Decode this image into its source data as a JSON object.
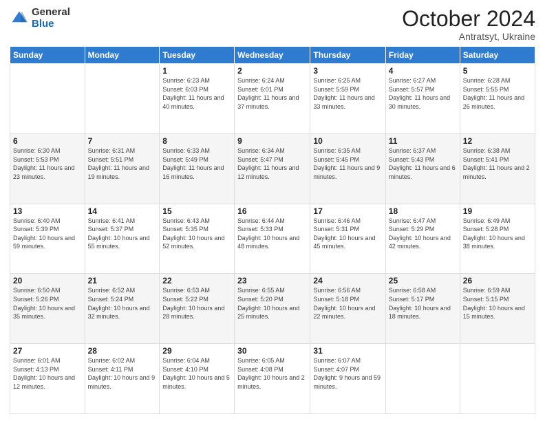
{
  "logo": {
    "general": "General",
    "blue": "Blue"
  },
  "header": {
    "month": "October 2024",
    "location": "Antratsyt, Ukraine"
  },
  "weekdays": [
    "Sunday",
    "Monday",
    "Tuesday",
    "Wednesday",
    "Thursday",
    "Friday",
    "Saturday"
  ],
  "weeks": [
    [
      {
        "day": "",
        "info": ""
      },
      {
        "day": "",
        "info": ""
      },
      {
        "day": "1",
        "info": "Sunrise: 6:23 AM\nSunset: 6:03 PM\nDaylight: 11 hours and 40 minutes."
      },
      {
        "day": "2",
        "info": "Sunrise: 6:24 AM\nSunset: 6:01 PM\nDaylight: 11 hours and 37 minutes."
      },
      {
        "day": "3",
        "info": "Sunrise: 6:25 AM\nSunset: 5:59 PM\nDaylight: 11 hours and 33 minutes."
      },
      {
        "day": "4",
        "info": "Sunrise: 6:27 AM\nSunset: 5:57 PM\nDaylight: 11 hours and 30 minutes."
      },
      {
        "day": "5",
        "info": "Sunrise: 6:28 AM\nSunset: 5:55 PM\nDaylight: 11 hours and 26 minutes."
      }
    ],
    [
      {
        "day": "6",
        "info": "Sunrise: 6:30 AM\nSunset: 5:53 PM\nDaylight: 11 hours and 23 minutes."
      },
      {
        "day": "7",
        "info": "Sunrise: 6:31 AM\nSunset: 5:51 PM\nDaylight: 11 hours and 19 minutes."
      },
      {
        "day": "8",
        "info": "Sunrise: 6:33 AM\nSunset: 5:49 PM\nDaylight: 11 hours and 16 minutes."
      },
      {
        "day": "9",
        "info": "Sunrise: 6:34 AM\nSunset: 5:47 PM\nDaylight: 11 hours and 12 minutes."
      },
      {
        "day": "10",
        "info": "Sunrise: 6:35 AM\nSunset: 5:45 PM\nDaylight: 11 hours and 9 minutes."
      },
      {
        "day": "11",
        "info": "Sunrise: 6:37 AM\nSunset: 5:43 PM\nDaylight: 11 hours and 6 minutes."
      },
      {
        "day": "12",
        "info": "Sunrise: 6:38 AM\nSunset: 5:41 PM\nDaylight: 11 hours and 2 minutes."
      }
    ],
    [
      {
        "day": "13",
        "info": "Sunrise: 6:40 AM\nSunset: 5:39 PM\nDaylight: 10 hours and 59 minutes."
      },
      {
        "day": "14",
        "info": "Sunrise: 6:41 AM\nSunset: 5:37 PM\nDaylight: 10 hours and 55 minutes."
      },
      {
        "day": "15",
        "info": "Sunrise: 6:43 AM\nSunset: 5:35 PM\nDaylight: 10 hours and 52 minutes."
      },
      {
        "day": "16",
        "info": "Sunrise: 6:44 AM\nSunset: 5:33 PM\nDaylight: 10 hours and 48 minutes."
      },
      {
        "day": "17",
        "info": "Sunrise: 6:46 AM\nSunset: 5:31 PM\nDaylight: 10 hours and 45 minutes."
      },
      {
        "day": "18",
        "info": "Sunrise: 6:47 AM\nSunset: 5:29 PM\nDaylight: 10 hours and 42 minutes."
      },
      {
        "day": "19",
        "info": "Sunrise: 6:49 AM\nSunset: 5:28 PM\nDaylight: 10 hours and 38 minutes."
      }
    ],
    [
      {
        "day": "20",
        "info": "Sunrise: 6:50 AM\nSunset: 5:26 PM\nDaylight: 10 hours and 35 minutes."
      },
      {
        "day": "21",
        "info": "Sunrise: 6:52 AM\nSunset: 5:24 PM\nDaylight: 10 hours and 32 minutes."
      },
      {
        "day": "22",
        "info": "Sunrise: 6:53 AM\nSunset: 5:22 PM\nDaylight: 10 hours and 28 minutes."
      },
      {
        "day": "23",
        "info": "Sunrise: 6:55 AM\nSunset: 5:20 PM\nDaylight: 10 hours and 25 minutes."
      },
      {
        "day": "24",
        "info": "Sunrise: 6:56 AM\nSunset: 5:18 PM\nDaylight: 10 hours and 22 minutes."
      },
      {
        "day": "25",
        "info": "Sunrise: 6:58 AM\nSunset: 5:17 PM\nDaylight: 10 hours and 18 minutes."
      },
      {
        "day": "26",
        "info": "Sunrise: 6:59 AM\nSunset: 5:15 PM\nDaylight: 10 hours and 15 minutes."
      }
    ],
    [
      {
        "day": "27",
        "info": "Sunrise: 6:01 AM\nSunset: 4:13 PM\nDaylight: 10 hours and 12 minutes."
      },
      {
        "day": "28",
        "info": "Sunrise: 6:02 AM\nSunset: 4:11 PM\nDaylight: 10 hours and 9 minutes."
      },
      {
        "day": "29",
        "info": "Sunrise: 6:04 AM\nSunset: 4:10 PM\nDaylight: 10 hours and 5 minutes."
      },
      {
        "day": "30",
        "info": "Sunrise: 6:05 AM\nSunset: 4:08 PM\nDaylight: 10 hours and 2 minutes."
      },
      {
        "day": "31",
        "info": "Sunrise: 6:07 AM\nSunset: 4:07 PM\nDaylight: 9 hours and 59 minutes."
      },
      {
        "day": "",
        "info": ""
      },
      {
        "day": "",
        "info": ""
      }
    ]
  ]
}
